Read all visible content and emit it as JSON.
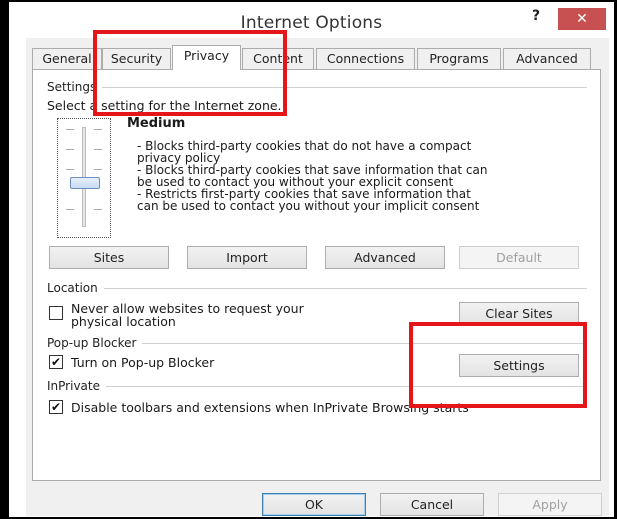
{
  "window": {
    "title": "Internet Options",
    "help_label": "?",
    "close_label": "✕"
  },
  "tabs": [
    {
      "label": "General"
    },
    {
      "label": "Security"
    },
    {
      "label": "Privacy"
    },
    {
      "label": "Content"
    },
    {
      "label": "Connections"
    },
    {
      "label": "Programs"
    },
    {
      "label": "Advanced"
    }
  ],
  "active_tab": "Privacy",
  "settings": {
    "group_label": "Settings",
    "intro": "Select a setting for the Internet zone.",
    "level": "Medium",
    "slider_level_fraction": 0.6,
    "description_lines": [
      "- Blocks third-party cookies that do not have a compact",
      "privacy policy",
      "- Blocks third-party cookies that save information that can",
      "be used to contact you without your explicit consent",
      "- Restricts first-party cookies that save information that",
      "can be used to contact you without your implicit consent"
    ],
    "buttons": {
      "sites": "Sites",
      "import": "Import",
      "advanced": "Advanced",
      "default": "Default"
    }
  },
  "location": {
    "group_label": "Location",
    "checkbox_label_line1": "Never allow websites to request your",
    "checkbox_label_line2": "physical location",
    "checked": false,
    "clear_sites": "Clear Sites"
  },
  "popup": {
    "group_label": "Pop-up Blocker",
    "checkbox_label": "Turn on Pop-up Blocker",
    "checked": true,
    "settings_button": "Settings"
  },
  "inprivate": {
    "group_label": "InPrivate",
    "checkbox_label": "Disable toolbars and extensions when InPrivate Browsing starts",
    "checked": true
  },
  "footer": {
    "ok": "OK",
    "cancel": "Cancel",
    "apply": "Apply"
  },
  "check_glyph": "✔",
  "colors": {
    "highlight": "#e4161a",
    "close_button": "#c75050"
  }
}
